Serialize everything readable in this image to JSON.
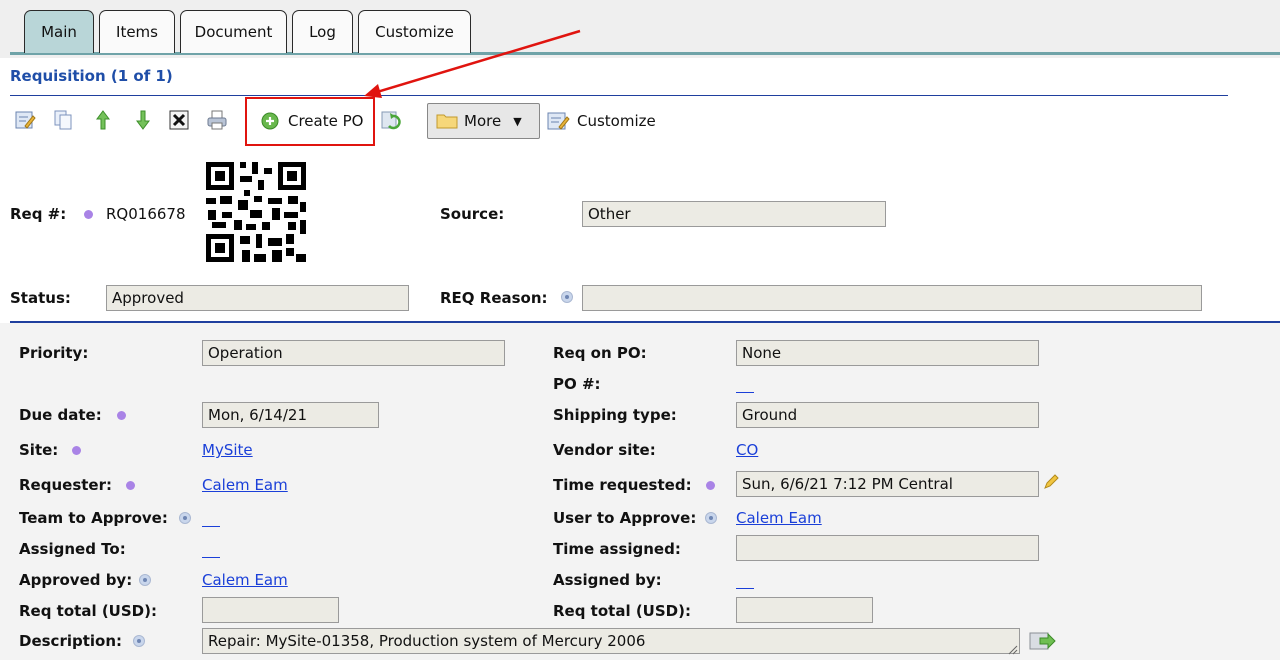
{
  "tabs": [
    {
      "label": "Main",
      "active": true
    },
    {
      "label": "Items",
      "active": false
    },
    {
      "label": "Document",
      "active": false
    },
    {
      "label": "Log",
      "active": false
    },
    {
      "label": "Customize",
      "active": false
    }
  ],
  "section_title": "Requisition (1 of 1)",
  "toolbar": {
    "icons": [
      "edit-icon",
      "copy-icon",
      "up-arrow-icon",
      "down-arrow-icon",
      "delete-icon",
      "print-icon"
    ],
    "create_po_label": "Create PO",
    "more_label": "More",
    "customize_label": "Customize"
  },
  "header": {
    "req_label": "Req #:",
    "req_value": "RQ016678",
    "source_label": "Source:",
    "source_value": "Other",
    "status_label": "Status:",
    "status_value": "Approved",
    "reason_label": "REQ Reason:",
    "reason_value": ""
  },
  "form_left": {
    "priority_label": "Priority:",
    "priority_value": "Operation",
    "due_label": "Due date:",
    "due_value": "Mon, 6/14/21",
    "site_label": "Site:",
    "site_value": "MySite",
    "requester_label": "Requester:",
    "requester_value": "Calem Eam",
    "team_label": "Team to Approve:",
    "team_value": "",
    "assigned_label": "Assigned To:",
    "assigned_value": "",
    "approved_label": "Approved by:",
    "approved_value": "Calem Eam",
    "total_label": "Req total (USD):",
    "total_value": "",
    "desc_label": "Description:",
    "desc_value": "Repair: MySite-01358, Production system of Mercury 2006"
  },
  "form_right": {
    "reqpo_label": "Req on PO:",
    "reqpo_value": "None",
    "ponum_label": "PO #:",
    "ponum_value": "",
    "ship_label": "Shipping type:",
    "ship_value": "Ground",
    "vendor_label": "Vendor site:",
    "vendor_value": "CO",
    "timereq_label": "Time requested:",
    "timereq_value": "Sun, 6/6/21 7:12 PM Central",
    "user_label": "User to Approve:",
    "user_value": "Calem Eam",
    "timeassigned_label": "Time assigned:",
    "timeassigned_value": "",
    "assignedby_label": "Assigned by:",
    "assignedby_value": "",
    "total_label": "Req total (USD):",
    "total_value": ""
  },
  "colors": {
    "section_title": "#1f4ea8",
    "active_tab": "#b9d6d8",
    "link": "#1a3fd8",
    "annotation": "#e0140f",
    "required_dot": "#a983e6",
    "field_bg": "#ecebe4"
  }
}
